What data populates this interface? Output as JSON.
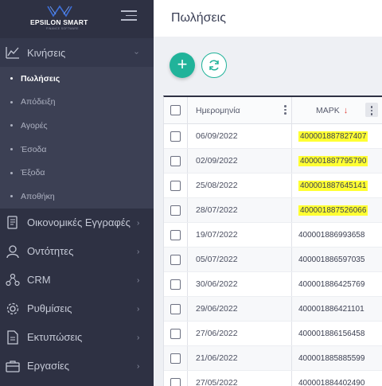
{
  "brand": {
    "name": "EPSILON SMART",
    "sub": "FINANCE SOFTWARE"
  },
  "nav": {
    "kiniseis": "Κινήσεις",
    "sub_items": [
      "Πωλήσεις",
      "Απόδειξη",
      "Αγορές",
      "Έσοδα",
      "Έξοδα",
      "Αποθήκη"
    ],
    "oikonomikes": "Οικονομικές Εγγραφές",
    "ontotites": "Οντότητες",
    "crm": "CRM",
    "rythmiseis": "Ρυθμίσεις",
    "ektyposeis": "Εκτυπώσεις",
    "ergasies": "Εργασίες"
  },
  "page": {
    "title": "Πωλήσεις"
  },
  "toolbar": {
    "add_label": "+"
  },
  "grid": {
    "col_date": "Ημερομηνία",
    "col_mark": "ΜΑΡΚ",
    "sort_arrow": "↓",
    "rows": [
      {
        "date": "06/09/2022",
        "mark": "400001887827407",
        "highlight": true
      },
      {
        "date": "02/09/2022",
        "mark": "400001887795790",
        "highlight": true
      },
      {
        "date": "25/08/2022",
        "mark": "400001887645141",
        "highlight": true
      },
      {
        "date": "28/07/2022",
        "mark": "400001887526066",
        "highlight": true
      },
      {
        "date": "19/07/2022",
        "mark": "400001886993658",
        "highlight": false
      },
      {
        "date": "05/07/2022",
        "mark": "400001886597035",
        "highlight": false
      },
      {
        "date": "30/06/2022",
        "mark": "400001886425769",
        "highlight": false
      },
      {
        "date": "29/06/2022",
        "mark": "400001886421101",
        "highlight": false
      },
      {
        "date": "27/06/2022",
        "mark": "400001886156458",
        "highlight": false
      },
      {
        "date": "21/06/2022",
        "mark": "400001885885599",
        "highlight": false
      },
      {
        "date": "27/05/2022",
        "mark": "400001884402490",
        "highlight": false
      }
    ]
  },
  "colors": {
    "sidebar": "#2e3143",
    "accent": "#21b39a",
    "highlight": "#ffff33"
  }
}
